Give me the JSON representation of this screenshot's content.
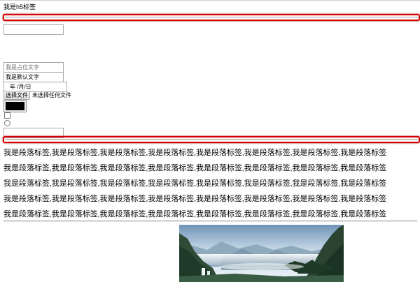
{
  "heading": "我是h5标签",
  "form": {
    "text_input_value": "",
    "placeholder_input": {
      "placeholder": "我是占位文字",
      "value": ""
    },
    "default_input_value": "我是默认文字",
    "date_input_text": "年 /月/日",
    "file_input": {
      "button_label": "选择文件",
      "status": "未选择任何文件"
    },
    "color_input_value": "#000000",
    "checkbox_checked": false,
    "radio_checked": false,
    "last_input_value": ""
  },
  "paragraphs": [
    "我是段落标签,我是段落标签,我是段落标签,我是段落标签,我是段落标签,我是段落标签,我是段落标签,我是段落标签",
    "我是段落标签,我是段落标签,我是段落标签,我是段落标签,我是段落标签,我是段落标签,我是段落标签,我是段落标签",
    "我是段落标签,我是段落标签,我是段落标签,我是段落标签,我是段落标签,我是段落标签,我是段落标签,我是段落标签",
    "我是段落标签,我是段落标签,我是段落标签,我是段落标签,我是段落标签,我是段落标签,我是段落标签,我是段落标签",
    "我是段落标签,我是段落标签,我是段落标签,我是段落标签,我是段落标签,我是段落标签,我是段落标签,我是段落标签"
  ],
  "colors": {
    "highlight_border": "#d40000",
    "input_border": "#a9a9a9",
    "placeholder_text": "#9a9a9a"
  }
}
